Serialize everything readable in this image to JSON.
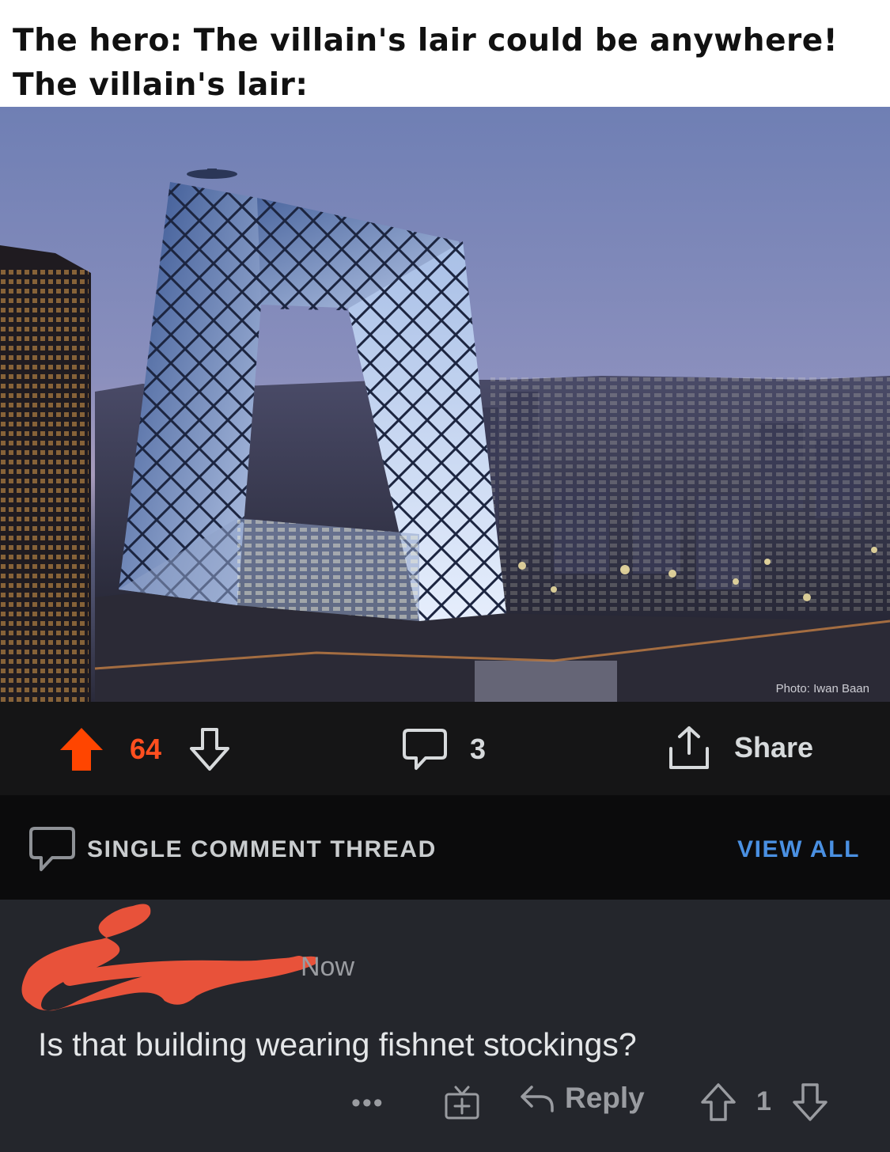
{
  "caption": {
    "line1": "The hero: The villain's lair could be anywhere!",
    "line2": "The villain's lair:"
  },
  "photo": {
    "credit": "Photo: Iwan Baan"
  },
  "post_actions": {
    "score": "64",
    "comment_count": "3",
    "share_label": "Share",
    "upvote_color": "#ff4500",
    "upvote_state": "active",
    "icons": [
      "arrow-up-icon",
      "arrow-down-icon",
      "comment-bubble-icon",
      "share-icon"
    ]
  },
  "thread": {
    "title": "SINGLE COMMENT THREAD",
    "view_all_label": "VIEW ALL",
    "link_color": "#4a90e2"
  },
  "comment": {
    "time": "Now",
    "body": "Is that building wearing fishnet stockings?",
    "more_label": "•••",
    "reply_label": "Reply",
    "score": "1",
    "redaction_color": "#e8523a",
    "icons": [
      "more-icon",
      "award-icon",
      "reply-icon",
      "arrow-up-icon",
      "arrow-down-icon"
    ]
  }
}
